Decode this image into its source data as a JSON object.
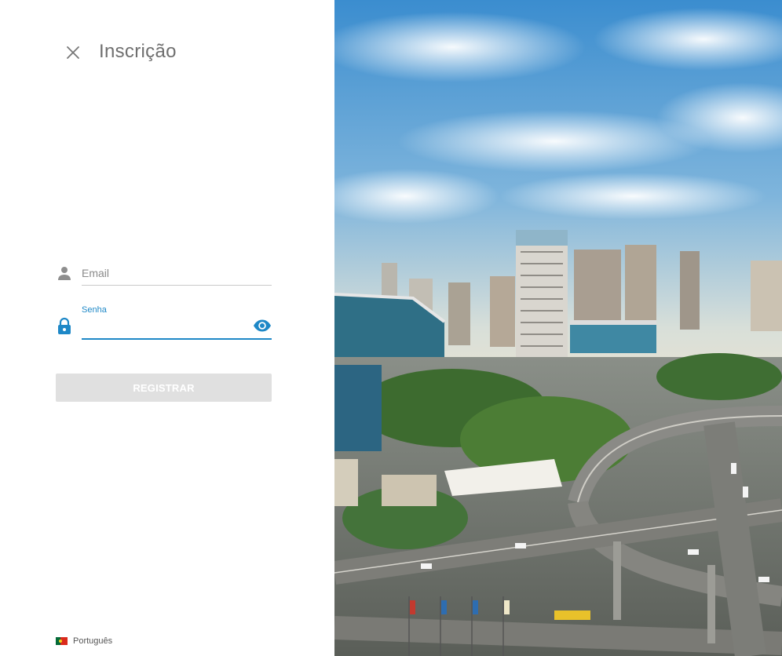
{
  "header": {
    "title": "Inscrição",
    "close_icon": "close-icon"
  },
  "form": {
    "email": {
      "placeholder": "Email",
      "value": "",
      "icon": "person-icon"
    },
    "password": {
      "label": "Senha",
      "value": "",
      "icon": "lock-icon",
      "toggle_icon": "eye-icon"
    },
    "submit_label": "REGISTRAR"
  },
  "footer": {
    "language_label": "Português",
    "flag": "portugal-flag-icon"
  },
  "colors": {
    "accent": "#1e88c7",
    "title_text": "#6f6f6f",
    "disabled_button": "#e0e0e0",
    "underline": "#c9c9c9"
  },
  "hero_image": {
    "subject": "city-skyline-with-highway-interchange"
  }
}
